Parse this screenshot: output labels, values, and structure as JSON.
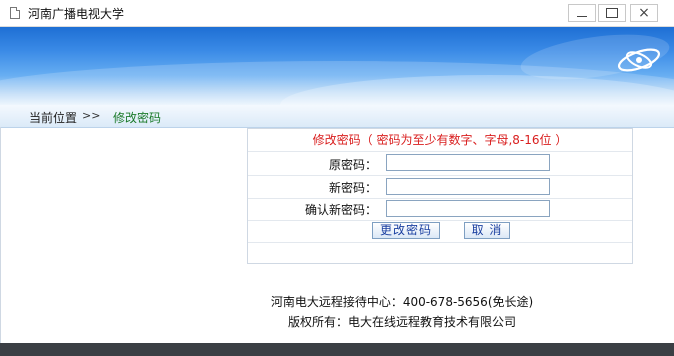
{
  "window": {
    "title": "河南广播电视大学",
    "minimize_label": "",
    "maximize_label": "",
    "close_label": "×"
  },
  "breadcrumb": {
    "label": "当前位置",
    "separator": ">>",
    "current": "修改密码"
  },
  "form": {
    "heading": "修改密码（ 密码为至少有数字、字母,8-16位 ）",
    "fields": [
      {
        "label": "原密码：",
        "value": ""
      },
      {
        "label": "新密码：",
        "value": ""
      },
      {
        "label": "确认新密码：",
        "value": ""
      }
    ],
    "submit_label": "更改密码",
    "cancel_label": "取  消"
  },
  "footer": {
    "contact": "河南电大远程接待中心：400-678-5656(免长途)",
    "copyright": "版权所有：电大在线远程教育技术有限公司"
  },
  "colors": {
    "heading_red": "#d91e1e",
    "breadcrumb_green": "#1b7a2a",
    "banner_blue": "#1e6fd4",
    "button_text": "#1a3fa0"
  },
  "icons": {
    "app": "document-icon",
    "logo": "ring-logo-icon"
  }
}
